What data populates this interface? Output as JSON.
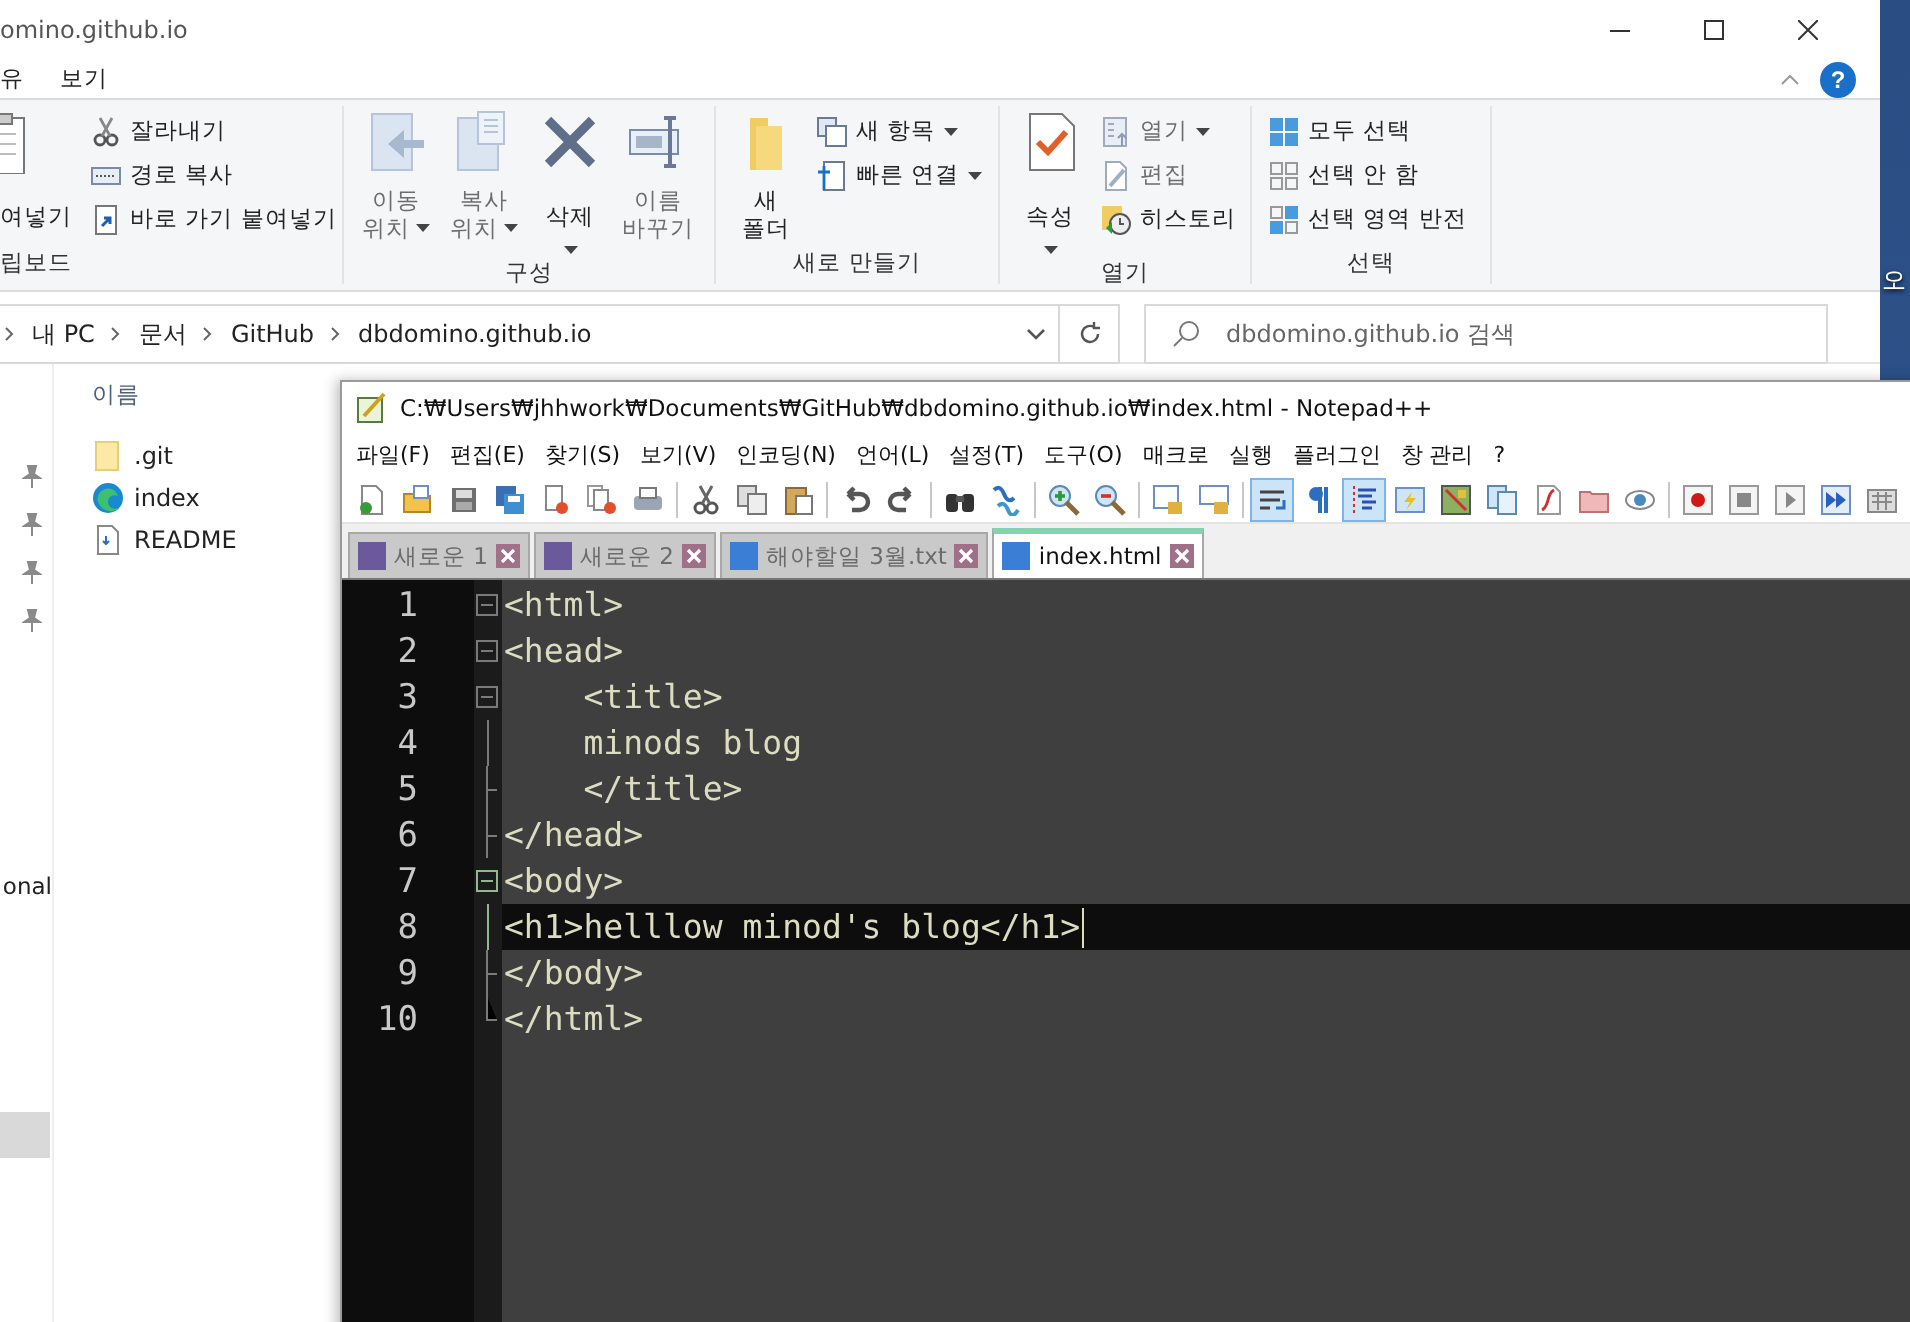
{
  "desktop": {
    "icon_label": "오"
  },
  "explorer": {
    "title": "omino.github.io",
    "menu": [
      {
        "label": "유"
      },
      {
        "label": "보기"
      }
    ],
    "help": "?",
    "ribbon": [
      {
        "label": "립보드",
        "items": [
          {
            "kind": "large",
            "lines": [
              "여넣기"
            ],
            "disabled": false,
            "dropdown": false
          },
          {
            "kind": "stack",
            "rows": [
              {
                "label": "잘라내기",
                "disabled": false,
                "dropdown": false
              },
              {
                "label": "경로 복사",
                "disabled": false,
                "dropdown": false
              },
              {
                "label": "바로 가기 붙여넣기",
                "disabled": false,
                "dropdown": false
              }
            ]
          }
        ]
      },
      {
        "label": "구성",
        "items": [
          {
            "kind": "large",
            "lines": [
              "이동",
              "위치"
            ],
            "disabled": true,
            "dropdown": true
          },
          {
            "kind": "large",
            "lines": [
              "복사",
              "위치"
            ],
            "disabled": true,
            "dropdown": true
          },
          {
            "kind": "large",
            "lines": [
              "삭제"
            ],
            "disabled": false,
            "dropdown": true
          },
          {
            "kind": "large",
            "lines": [
              "이름",
              "바꾸기"
            ],
            "disabled": true,
            "dropdown": false
          }
        ]
      },
      {
        "label": "새로 만들기",
        "items": [
          {
            "kind": "large",
            "lines": [
              "새",
              "폴더"
            ],
            "disabled": false,
            "dropdown": false
          },
          {
            "kind": "stack",
            "rows": [
              {
                "label": "새 항목",
                "disabled": false,
                "dropdown": true
              },
              {
                "label": "빠른 연결",
                "disabled": false,
                "dropdown": true
              }
            ]
          }
        ]
      },
      {
        "label": "열기",
        "items": [
          {
            "kind": "large",
            "lines": [
              "속성"
            ],
            "disabled": false,
            "dropdown": true
          },
          {
            "kind": "stack",
            "rows": [
              {
                "label": "열기",
                "disabled": true,
                "dropdown": true
              },
              {
                "label": "편집",
                "disabled": true,
                "dropdown": false
              },
              {
                "label": "히스토리",
                "disabled": false,
                "dropdown": false
              }
            ]
          }
        ]
      },
      {
        "label": "선택",
        "items": [
          {
            "kind": "stack",
            "rows": [
              {
                "label": "모두 선택",
                "disabled": false,
                "dropdown": false
              },
              {
                "label": "선택 안 함",
                "disabled": false,
                "dropdown": false
              },
              {
                "label": "선택 영역 반전",
                "disabled": false,
                "dropdown": false
              }
            ]
          }
        ]
      }
    ],
    "path": [
      "내 PC",
      "문서",
      "GitHub",
      "dbdomino.github.io"
    ],
    "search": {
      "placeholder": "dbdomino.github.io 검색"
    },
    "nav": {
      "label": "onal"
    },
    "files": {
      "header": "이름",
      "items": [
        {
          "name": ".git",
          "kind": "folder"
        },
        {
          "name": "index",
          "kind": "browser"
        },
        {
          "name": "README",
          "kind": "file"
        }
      ]
    }
  },
  "notepad": {
    "title": "C:₩Users₩jhhwork₩Documents₩GitHub₩dbdomino.github.io₩index.html - Notepad++",
    "menu": [
      "파일(F)",
      "편집(E)",
      "찾기(S)",
      "보기(V)",
      "인코딩(N)",
      "언어(L)",
      "설정(T)",
      "도구(O)",
      "매크로",
      "실행",
      "플러그인",
      "창 관리",
      "?"
    ],
    "toolbar": [
      {
        "kind": "new",
        "on": false
      },
      {
        "kind": "open",
        "on": false
      },
      {
        "kind": "save",
        "on": false
      },
      {
        "kind": "saveall",
        "on": false
      },
      {
        "kind": "close",
        "on": false
      },
      {
        "kind": "closeall",
        "on": false
      },
      {
        "kind": "print",
        "on": false
      },
      {
        "kind": "separator"
      },
      {
        "kind": "cut",
        "on": false
      },
      {
        "kind": "copy",
        "on": false
      },
      {
        "kind": "paste",
        "on": false
      },
      {
        "kind": "separator"
      },
      {
        "kind": "undo",
        "on": false
      },
      {
        "kind": "redo",
        "on": false
      },
      {
        "kind": "separator"
      },
      {
        "kind": "find",
        "on": false
      },
      {
        "kind": "replace",
        "on": false
      },
      {
        "kind": "separator"
      },
      {
        "kind": "zoomin",
        "on": false
      },
      {
        "kind": "zoomout",
        "on": false
      },
      {
        "kind": "separator"
      },
      {
        "kind": "syncv",
        "on": false
      },
      {
        "kind": "synch",
        "on": false
      },
      {
        "kind": "separator"
      },
      {
        "kind": "wrap",
        "on": true
      },
      {
        "kind": "pilcrow",
        "on": false
      },
      {
        "kind": "indent",
        "on": true
      },
      {
        "kind": "udl",
        "on": false
      },
      {
        "kind": "docmap",
        "on": false
      },
      {
        "kind": "doclist",
        "on": false
      },
      {
        "kind": "funclist",
        "on": false
      },
      {
        "kind": "workspace",
        "on": false
      },
      {
        "kind": "monitor",
        "on": false
      },
      {
        "kind": "separator"
      },
      {
        "kind": "record",
        "on": false
      },
      {
        "kind": "stop",
        "on": false
      },
      {
        "kind": "play",
        "on": false
      },
      {
        "kind": "playmulti",
        "on": false
      },
      {
        "kind": "savemacro",
        "on": false
      }
    ],
    "tabs": [
      {
        "label": "새로운 1",
        "selected": false,
        "color": "#6a5a9c"
      },
      {
        "label": "새로운 2",
        "selected": false,
        "color": "#6a5a9c"
      },
      {
        "label": "해야할일 3월.txt",
        "selected": false,
        "color": "#3a7fd5"
      },
      {
        "label": "index.html",
        "selected": true,
        "color": "#3a7fd5"
      }
    ],
    "lines": [
      {
        "number": "1",
        "text": "<html>",
        "kind": "box",
        "fold_active": false,
        "current": false
      },
      {
        "number": "2",
        "text": "<head>",
        "kind": "box",
        "fold_active": false,
        "current": false
      },
      {
        "number": "3",
        "text": "    <title>",
        "kind": "box",
        "fold_active": false,
        "current": false
      },
      {
        "number": "4",
        "text": "    minods blog",
        "kind": "line",
        "fold_active": false,
        "current": false
      },
      {
        "number": "5",
        "text": "    </title>",
        "kind": "end",
        "fold_active": false,
        "current": false
      },
      {
        "number": "6",
        "text": "</head>",
        "kind": "end",
        "fold_active": false,
        "current": false
      },
      {
        "number": "7",
        "text": "<body>",
        "kind": "box",
        "fold_active": true,
        "current": false
      },
      {
        "number": "8",
        "text": "<h1>helllow minod's blog</h1>",
        "kind": "line",
        "fold_active": true,
        "current": true
      },
      {
        "number": "9",
        "text": "</body>",
        "kind": "end",
        "fold_active": false,
        "current": false
      },
      {
        "number": "10",
        "text": "</html>",
        "kind": "last",
        "fold_active": false,
        "current": false
      }
    ]
  }
}
